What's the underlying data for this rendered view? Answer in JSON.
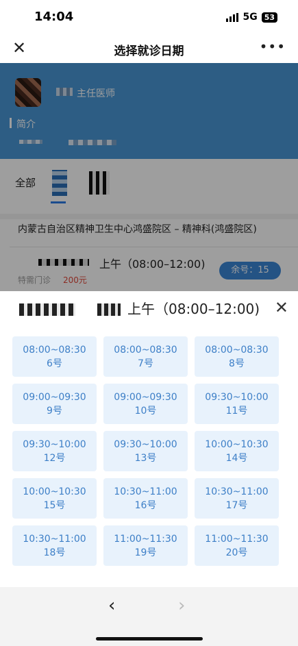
{
  "status_bar": {
    "time": "14:04",
    "network": "5G",
    "battery": "53"
  },
  "nav": {
    "close_icon": "close-icon",
    "title": "选择就诊日期",
    "more_icon": "more-icon"
  },
  "doctor": {
    "title": "主任医师",
    "intro_label": "简介"
  },
  "filter": {
    "all_label": "全部"
  },
  "hospital": {
    "name": "内蒙古自治区精神卫生中心鸿盛院区 – 精神科(鸿盛院区)"
  },
  "schedule_row": {
    "session": "上午（08:00–12:00)",
    "clinic_type": "特需门诊",
    "price": "200元",
    "remain_label": "余号：15"
  },
  "sheet": {
    "title": "上午（08:00–12:00)",
    "close_icon": "close-icon"
  },
  "slots": [
    {
      "time": "08:00~08:30",
      "number": "6号"
    },
    {
      "time": "08:00~08:30",
      "number": "7号"
    },
    {
      "time": "08:00~08:30",
      "number": "8号"
    },
    {
      "time": "09:00~09:30",
      "number": "9号"
    },
    {
      "time": "09:00~09:30",
      "number": "10号"
    },
    {
      "time": "09:30~10:00",
      "number": "11号"
    },
    {
      "time": "09:30~10:00",
      "number": "12号"
    },
    {
      "time": "09:30~10:00",
      "number": "13号"
    },
    {
      "time": "10:00~10:30",
      "number": "14号"
    },
    {
      "time": "10:00~10:30",
      "number": "15号"
    },
    {
      "time": "10:30~11:00",
      "number": "16号"
    },
    {
      "time": "10:30~11:00",
      "number": "17号"
    },
    {
      "time": "10:30~11:00",
      "number": "18号"
    },
    {
      "time": "11:00~11:30",
      "number": "19号"
    },
    {
      "time": "11:00~11:30",
      "number": "20号"
    }
  ],
  "pager": {
    "prev": "‹",
    "next": "›"
  },
  "colors": {
    "header_blue": "#4a97d5",
    "slot_bg": "#e8f2fc",
    "slot_text": "#3d7fc7",
    "price_red": "#e0483a"
  }
}
